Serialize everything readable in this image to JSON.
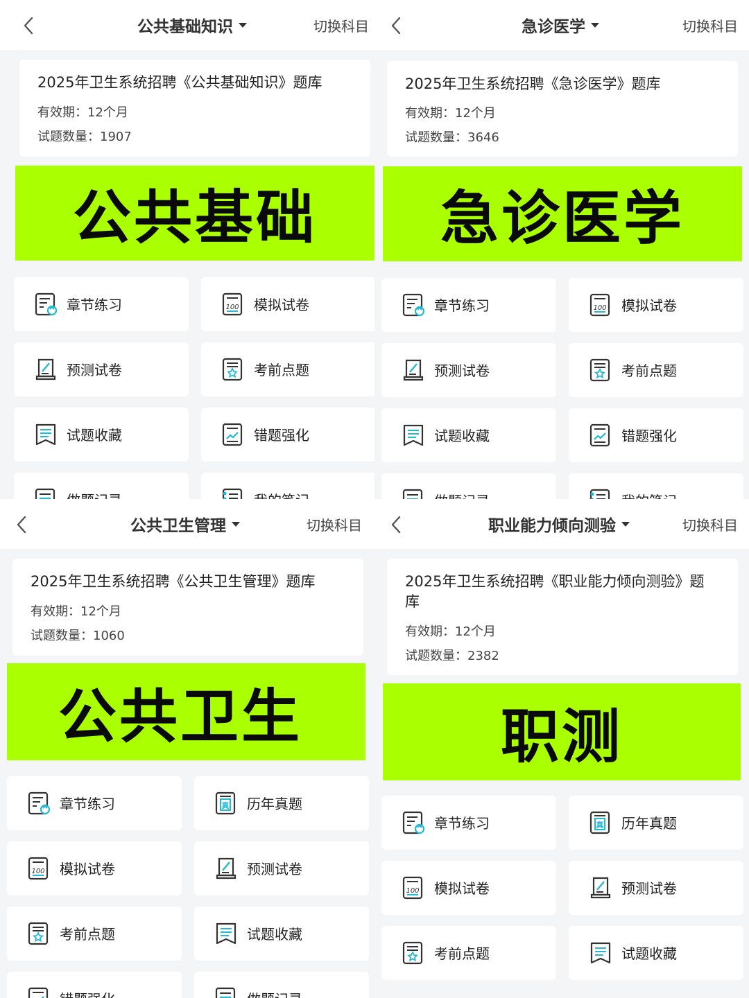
{
  "colors": {
    "banner": "#aaff00",
    "accent": "#22b8d6",
    "icon_stroke": "#333333"
  },
  "common": {
    "switch_label": "切换科目"
  },
  "panels": [
    {
      "title": "公共基础知识",
      "info_title": "2025年卫生系统招聘《公共基础知识》题库",
      "validity": "有效期：12个月",
      "count": "试题数量：1907",
      "banner": "公共基础",
      "tiles": [
        "章节练习",
        "模拟试卷",
        "预测试卷",
        "考前点题",
        "试题收藏",
        "错题强化",
        "做题记录",
        "我的笔记"
      ]
    },
    {
      "title": "急诊医学",
      "info_title": "2025年卫生系统招聘《急诊医学》题库",
      "validity": "有效期：12个月",
      "count": "试题数量：3646",
      "banner": "急诊医学",
      "tiles": [
        "章节练习",
        "模拟试卷",
        "预测试卷",
        "考前点题",
        "试题收藏",
        "错题强化",
        "做题记录",
        "我的笔记"
      ]
    },
    {
      "title": "公共卫生管理",
      "info_title": "2025年卫生系统招聘《公共卫生管理》题库",
      "validity": "有效期：12个月",
      "count": "试题数量：1060",
      "banner": "公共卫生",
      "tiles": [
        "章节练习",
        "历年真题",
        "模拟试卷",
        "预测试卷",
        "考前点题",
        "试题收藏",
        "错题强化",
        "做题记录"
      ]
    },
    {
      "title": "职业能力倾向测验",
      "info_title_line1": "2025年卫生系统招聘《职业能力倾向测验》题",
      "info_title_line2": "库",
      "validity": "有效期：12个月",
      "count": "试题数量：2382",
      "banner": "职测",
      "tiles": [
        "章节练习",
        "历年真题",
        "模拟试卷",
        "预测试卷",
        "考前点题",
        "试题收藏"
      ]
    }
  ],
  "icons": {
    "章节练习": "chapter-practice-icon",
    "模拟试卷": "mock-exam-icon",
    "预测试卷": "forecast-paper-icon",
    "考前点题": "pre-exam-tips-icon",
    "试题收藏": "favorites-icon",
    "错题强化": "mistake-review-icon",
    "做题记录": "practice-record-icon",
    "我的笔记": "notes-icon",
    "历年真题": "past-papers-icon"
  }
}
